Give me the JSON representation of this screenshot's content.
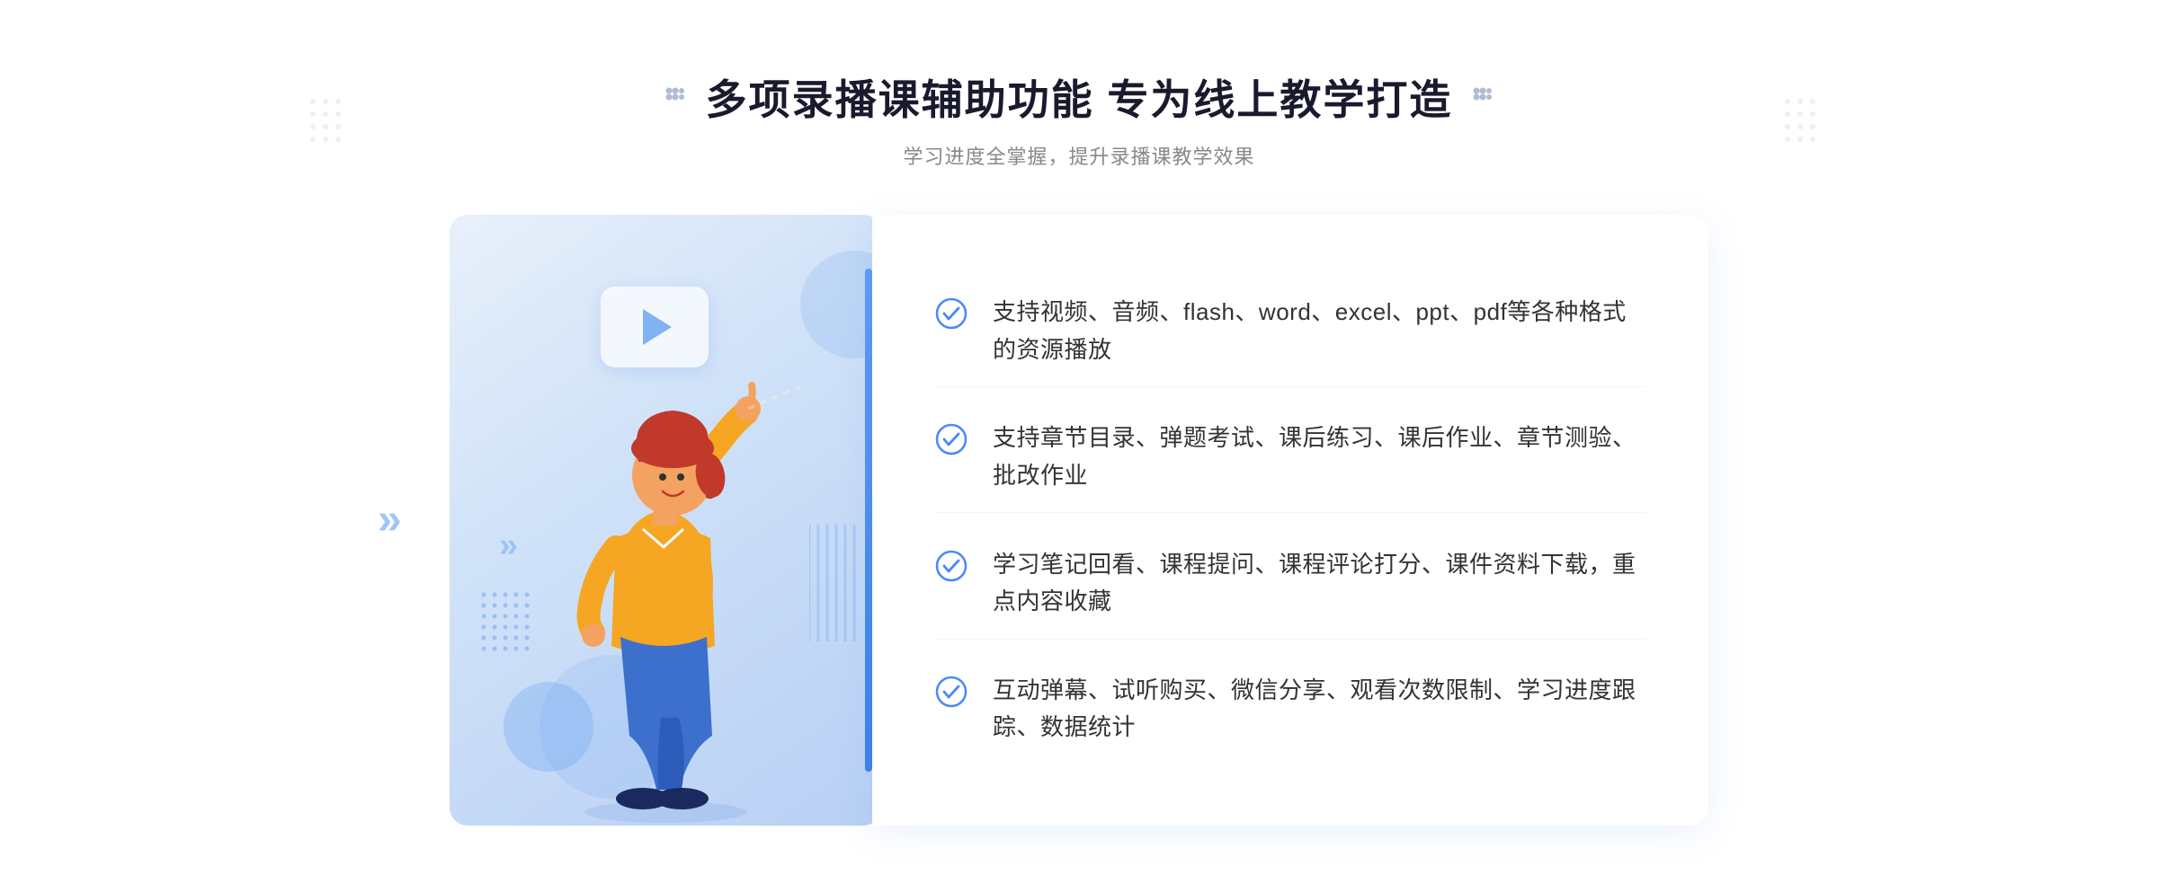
{
  "header": {
    "main_title": "多项录播课辅助功能 专为线上教学打造",
    "subtitle": "学习进度全掌握，提升录播课教学效果"
  },
  "features": [
    {
      "id": "feature-1",
      "text": "支持视频、音频、flash、word、excel、ppt、pdf等各种格式的资源播放"
    },
    {
      "id": "feature-2",
      "text": "支持章节目录、弹题考试、课后练习、课后作业、章节测验、批改作业"
    },
    {
      "id": "feature-3",
      "text": "学习笔记回看、课程提问、课程评论打分、课件资料下载，重点内容收藏"
    },
    {
      "id": "feature-4",
      "text": "互动弹幕、试听购买、微信分享、观看次数限制、学习进度跟踪、数据统计"
    }
  ],
  "colors": {
    "primary_blue": "#4a8af4",
    "title_dark": "#1a1a2e",
    "text_gray": "#888888",
    "feature_text": "#333333",
    "check_blue": "#4a8af4"
  }
}
